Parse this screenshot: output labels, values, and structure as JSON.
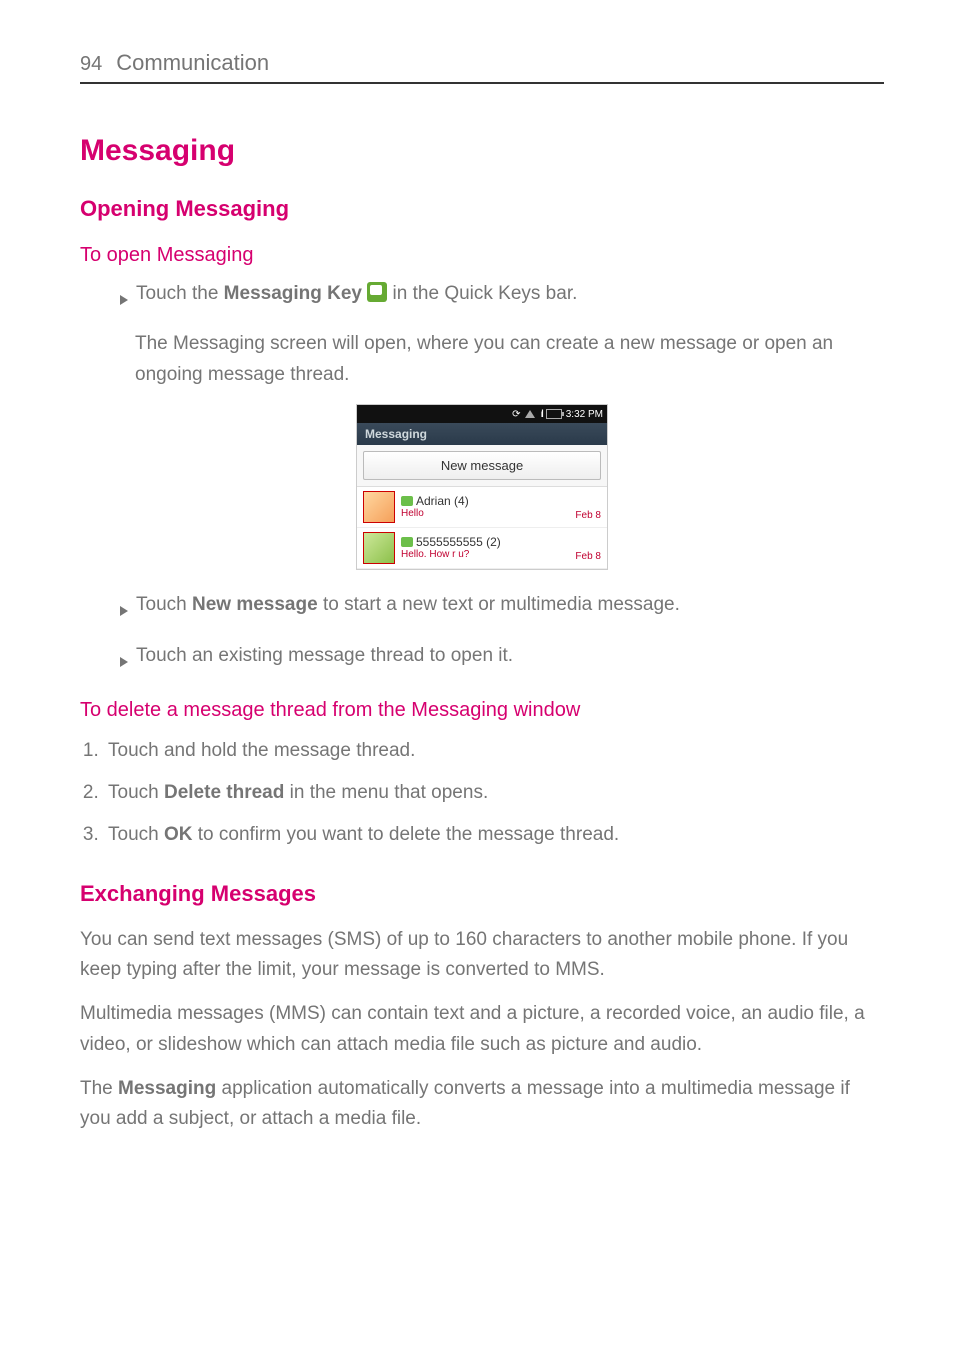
{
  "header": {
    "page_number": "94",
    "section": "Communication"
  },
  "h1": "Messaging",
  "h2a": "Opening Messaging",
  "h3a": "To open Messaging",
  "bullet1_pre": "Touch the ",
  "bullet1_bold": "Messaging Key",
  "bullet1_post": " in the Quick Keys bar.",
  "para1": "The Messaging screen will open, where you can create a new message or open an ongoing message thread.",
  "screenshot": {
    "statusbar_time": "3:32 PM",
    "title": "Messaging",
    "new_message": "New message",
    "threads": [
      {
        "name": "Adrian (4)",
        "preview": "Hello",
        "date": "Feb 8"
      },
      {
        "name": "5555555555 (2)",
        "preview": "Hello. How r u?",
        "date": "Feb 8"
      }
    ]
  },
  "bullet2_pre": "Touch ",
  "bullet2_bold": "New message",
  "bullet2_post": " to start a new text or multimedia message.",
  "bullet3": "Touch an existing message thread to open it.",
  "h3b": "To delete a message thread from the Messaging window",
  "steps": {
    "s1": "Touch and hold the message thread.",
    "s2_pre": "Touch ",
    "s2_bold": "Delete thread",
    "s2_post": " in the menu that opens.",
    "s3_pre": "Touch ",
    "s3_bold": "OK",
    "s3_post": " to confirm you want to delete the message thread."
  },
  "h2b": "Exchanging Messages",
  "para2": "You can send text messages (SMS) of up to 160 characters to another mobile phone. If you keep typing after the limit, your message is converted to MMS.",
  "para3": "Multimedia messages (MMS) can contain text and a picture, a recorded voice, an audio file, a video, or slideshow which can attach media file such as  picture and audio.",
  "para4_pre": "The ",
  "para4_bold": "Messaging",
  "para4_post": " application automatically converts a message into a multimedia message if you add a subject, or attach a media file."
}
